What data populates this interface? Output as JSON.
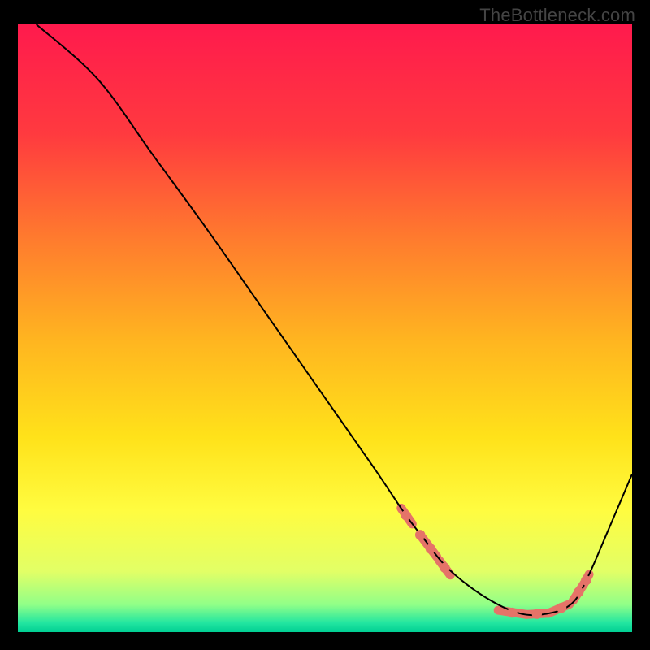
{
  "watermark": "TheBottleneck.com",
  "gradient": {
    "stops": [
      {
        "offset": 0.0,
        "color": "#ff1a4d"
      },
      {
        "offset": 0.18,
        "color": "#ff3a3f"
      },
      {
        "offset": 0.35,
        "color": "#ff7a2e"
      },
      {
        "offset": 0.52,
        "color": "#ffb520"
      },
      {
        "offset": 0.68,
        "color": "#ffe21a"
      },
      {
        "offset": 0.8,
        "color": "#fffc40"
      },
      {
        "offset": 0.9,
        "color": "#e2ff66"
      },
      {
        "offset": 0.955,
        "color": "#90ff88"
      },
      {
        "offset": 0.985,
        "color": "#22e6a0"
      },
      {
        "offset": 1.0,
        "color": "#00cf93"
      }
    ]
  },
  "chart_data": {
    "type": "line",
    "title": "",
    "xlabel": "",
    "ylabel": "",
    "xlim": [
      0,
      100
    ],
    "ylim": [
      0,
      100
    ],
    "grid": false,
    "series": [
      {
        "name": "bottleneck-curve",
        "x": [
          3,
          13,
          22,
          31,
          40,
          49,
          58,
          63,
          66,
          70,
          76,
          82,
          87,
          90.5,
          93,
          96,
          100
        ],
        "values": [
          100,
          91,
          78.5,
          66,
          53,
          40,
          27,
          19.5,
          15.5,
          10.5,
          5.8,
          3.0,
          3.2,
          5.0,
          9.5,
          16.5,
          26
        ]
      }
    ],
    "markers": [
      {
        "x": 63.2,
        "y": 19.2
      },
      {
        "x": 65.5,
        "y": 16.0
      },
      {
        "x": 67.2,
        "y": 13.7
      },
      {
        "x": 69.5,
        "y": 10.6
      },
      {
        "x": 80.5,
        "y": 3.2
      },
      {
        "x": 84.5,
        "y": 3.0
      },
      {
        "x": 88.5,
        "y": 4.0
      },
      {
        "x": 91.3,
        "y": 6.6
      },
      {
        "x": 92.5,
        "y": 8.5
      }
    ],
    "marker_segments": [
      {
        "x0": 62.4,
        "y0": 20.4,
        "x1": 64.2,
        "y1": 17.8
      },
      {
        "x0": 65.8,
        "y0": 15.6,
        "x1": 68.2,
        "y1": 12.4
      },
      {
        "x0": 68.6,
        "y0": 11.8,
        "x1": 70.4,
        "y1": 9.4
      },
      {
        "x0": 78.2,
        "y0": 3.6,
        "x1": 82.8,
        "y1": 2.9
      },
      {
        "x0": 82.8,
        "y0": 2.9,
        "x1": 86.4,
        "y1": 3.1
      },
      {
        "x0": 86.4,
        "y0": 3.1,
        "x1": 89.8,
        "y1": 4.6
      },
      {
        "x0": 90.4,
        "y0": 5.2,
        "x1": 92.2,
        "y1": 8.0
      },
      {
        "x0": 92.2,
        "y0": 8.0,
        "x1": 93.0,
        "y1": 9.5
      }
    ]
  },
  "colors": {
    "curve": "#000000",
    "marker_fill": "#e57368",
    "marker_stroke": "#e57368"
  }
}
